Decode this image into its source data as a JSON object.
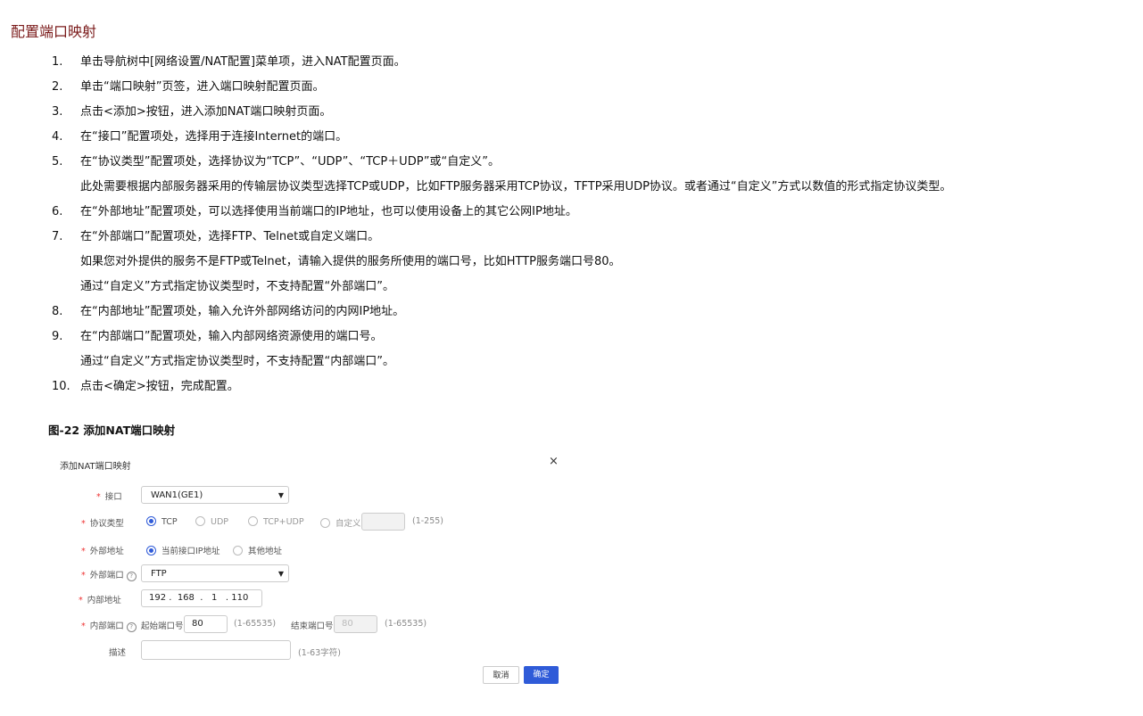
{
  "title": "配置端口映射",
  "steps": [
    {
      "num": "1.",
      "text": "单击导航树中[网络设置/NAT配置]菜单项，进入NAT配置页面。",
      "notes": []
    },
    {
      "num": "2.",
      "text": "单击“端口映射”页签，进入端口映射配置页面。",
      "notes": []
    },
    {
      "num": "3.",
      "text": "点击<添加>按钮，进入添加NAT端口映射页面。",
      "notes": []
    },
    {
      "num": "4.",
      "text": "在“接口”配置项处，选择用于连接Internet的端口。",
      "notes": []
    },
    {
      "num": "5.",
      "text": "在“协议类型”配置项处，选择协议为“TCP”、“UDP”、“TCP＋UDP”或“自定义”。",
      "notes": [
        "此处需要根据内部服务器采用的传输层协议类型选择TCP或UDP，比如FTP服务器采用TCP协议，TFTP采用UDP协议。或者通过“自定义”方式以数值的形式指定协议类型。"
      ]
    },
    {
      "num": "6.",
      "text": "在“外部地址”配置项处，可以选择使用当前端口的IP地址，也可以使用设备上的其它公网IP地址。",
      "notes": []
    },
    {
      "num": "7.",
      "text": "在“外部端口”配置项处，选择FTP、Telnet或自定义端口。",
      "notes": [
        "如果您对外提供的服务不是FTP或Telnet，请输入提供的服务所使用的端口号，比如HTTP服务端口号80。",
        "通过“自定义”方式指定协议类型时，不支持配置“外部端口”。"
      ]
    },
    {
      "num": "8.",
      "text": "在“内部地址”配置项处，输入允许外部网络访问的内网IP地址。",
      "notes": []
    },
    {
      "num": "9.",
      "text": "在“内部端口”配置项处，输入内部网络资源使用的端口号。",
      "notes": [
        "通过“自定义”方式指定协议类型时，不支持配置“内部端口”。"
      ]
    },
    {
      "num": "10.",
      "text": "点击<确定>按钮，完成配置。",
      "notes": []
    }
  ],
  "caption": "图-22 添加NAT端口映射",
  "dialog": {
    "title": "添加NAT端口映射",
    "close_icon": "×",
    "interface": {
      "label": "接口",
      "value": "WAN1(GE1)"
    },
    "protocol": {
      "label": "协议类型",
      "options": [
        "TCP",
        "UDP",
        "TCP+UDP",
        "自定义"
      ],
      "selected": "TCP",
      "custom_value": "",
      "hint": "(1-255)"
    },
    "ext_addr": {
      "label": "外部地址",
      "options": [
        "当前接口IP地址",
        "其他地址"
      ],
      "selected": "当前接口IP地址"
    },
    "ext_port": {
      "label": "外部端口",
      "value": "FTP"
    },
    "int_addr": {
      "label": "内部地址",
      "octets": [
        "192",
        "168",
        "1",
        "110"
      ]
    },
    "int_port": {
      "label": "内部端口",
      "start_label": "起始端口号",
      "start_value": "80",
      "start_hint": "(1-65535)",
      "end_label": "结束端口号",
      "end_value": "80",
      "end_hint": "(1-65535)"
    },
    "desc": {
      "label": "描述",
      "value": "",
      "hint": "(1-63字符)"
    },
    "cancel": "取消",
    "ok": "确定",
    "accent": "#2f5bd8"
  }
}
